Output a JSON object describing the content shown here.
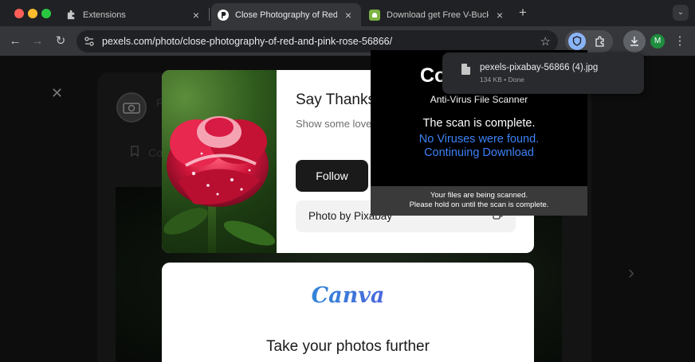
{
  "window": {
    "traffic_lights": [
      "close",
      "minimize",
      "zoom"
    ]
  },
  "tabs": [
    {
      "title": "Extensions",
      "favicon": "puzzle-icon",
      "close": "×"
    },
    {
      "title": "Close Photography of Red and",
      "favicon": "pexels-icon",
      "close": "×",
      "active": true
    },
    {
      "title": "Download get Free V-Bucks",
      "favicon": "android-icon",
      "close": "×"
    }
  ],
  "toolbar": {
    "back": "←",
    "forward": "→",
    "reload": "↻",
    "url": "pexels.com/photo/close-photography-of-red-and-pink-rose-56866/",
    "new_tab": "+",
    "tab_search": "⌄",
    "avatar_initial": "M",
    "menu": "⋮"
  },
  "page": {
    "close_glyph": "✕",
    "next_glyph": "›",
    "bg_photographer": "P",
    "bg_collect_label": "Co",
    "modal": {
      "heading": "Say Thanks",
      "body": "Show some love small donation.",
      "follow_label": "Follow",
      "credit": "Photo by Pixabay"
    },
    "canva": {
      "logo": "Canva",
      "heading": "Take your photos further"
    }
  },
  "scam_popup": {
    "title": "Co",
    "subtitle": "Anti-Virus File Scanner",
    "complete": "The scan is complete.",
    "no_viruses": "No Viruses were found.",
    "continuing": "Continuing Download",
    "footer_line1": "Your files are being scanned.",
    "footer_line2": "Please hold on until the scan is complete."
  },
  "download": {
    "filename": "pexels-pixabay-56866 (4).jpg",
    "meta": "134 KB • Done"
  },
  "colors": {
    "scan_blue": "#3b82f6",
    "rose": "#d1153a",
    "chrome_dark": "#202124"
  }
}
